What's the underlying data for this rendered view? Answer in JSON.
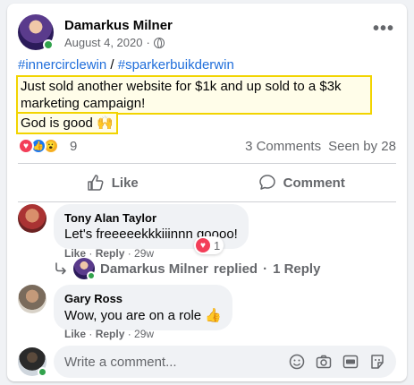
{
  "post": {
    "author": "Damarkus Milner",
    "date": "August 4, 2020",
    "date_separator": "·",
    "hashtags": [
      "#innercirclewin",
      "#sparkerbuikderwin"
    ],
    "hashtag_separator": " / ",
    "text_line1": "Just sold another website for $1k and up sold to a $3k marketing campaign!",
    "text_line2": "God is good 🙌",
    "more_label": "•••"
  },
  "reactions": {
    "count": "9",
    "comments": "3 Comments",
    "seen_by": "Seen by 28",
    "icons": [
      "love-icon",
      "like-icon",
      "wow-icon"
    ]
  },
  "actions": {
    "like": "Like",
    "comment": "Comment"
  },
  "comments": [
    {
      "name": "Tony Alan Taylor",
      "text": "Let's freeeeekkkiiinnn goooo!",
      "like": "Like",
      "reply": "Reply",
      "time": "29w",
      "reaction_count": "1"
    },
    {
      "name": "Gary Ross",
      "text": "Wow, you are on a role 👍",
      "like": "Like",
      "reply": "Reply",
      "time": "29w"
    }
  ],
  "reply_summary": {
    "author": "Damarkus Milner",
    "action": "replied",
    "dot": "·",
    "count": "1 Reply"
  },
  "composer": {
    "placeholder": "Write a comment..."
  },
  "colors": {
    "link": "#216fdb",
    "highlight_border": "#f2d400",
    "online": "#31a24c"
  }
}
